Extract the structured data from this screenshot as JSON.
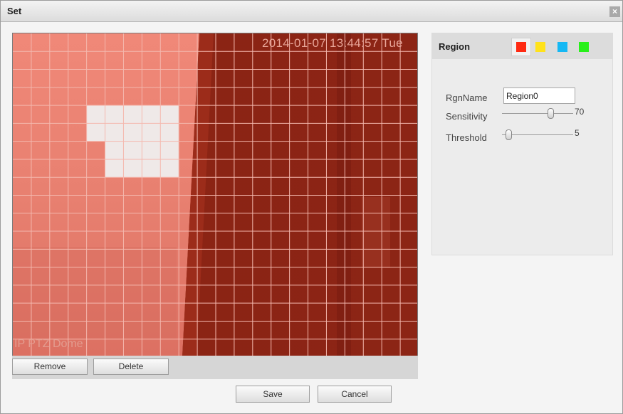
{
  "window": {
    "title": "Set",
    "close_glyph": "×"
  },
  "video": {
    "osd_time": "2014-01-07 13:44:57 Tue",
    "osd_name": "IP PTZ Dome",
    "overlay_color": "#c0392b",
    "grid": {
      "cols": 22,
      "rows": 18
    },
    "selected_cells": [
      [
        4,
        4
      ],
      [
        5,
        4
      ],
      [
        6,
        4
      ],
      [
        7,
        4
      ],
      [
        8,
        4
      ],
      [
        4,
        5
      ],
      [
        5,
        5
      ],
      [
        6,
        5
      ],
      [
        7,
        5
      ],
      [
        8,
        5
      ],
      [
        5,
        6
      ],
      [
        6,
        6
      ],
      [
        7,
        6
      ],
      [
        8,
        6
      ],
      [
        5,
        7
      ],
      [
        6,
        7
      ],
      [
        7,
        7
      ],
      [
        8,
        7
      ]
    ]
  },
  "toolbar": {
    "remove_label": "Remove",
    "delete_label": "Delete"
  },
  "footer": {
    "save_label": "Save",
    "cancel_label": "Cancel"
  },
  "region": {
    "title": "Region",
    "swatches": [
      {
        "name": "red",
        "color": "#ff2a12",
        "selected": true
      },
      {
        "name": "yellow",
        "color": "#ffe21a"
      },
      {
        "name": "blue",
        "color": "#15b8f4"
      },
      {
        "name": "green",
        "color": "#28f01a"
      }
    ],
    "rgn_name_label": "RgnName",
    "rgn_name_value": "Region0",
    "sensitivity_label": "Sensitivity",
    "sensitivity_value": "70",
    "threshold_label": "Threshold",
    "threshold_value": "5"
  }
}
